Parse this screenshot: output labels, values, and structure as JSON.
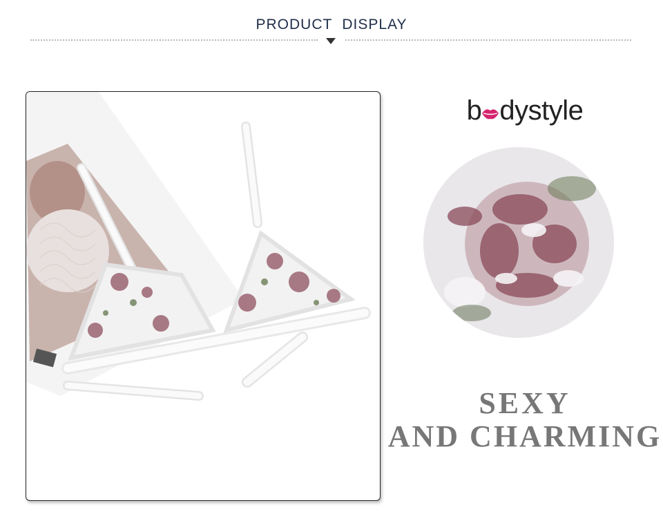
{
  "header": {
    "title_word1": "PRODUCT",
    "title_word2": "DISPLAY"
  },
  "brand": {
    "prefix": "b",
    "suffix": "dystyle",
    "accent_color": "#d6246e"
  },
  "tagline": {
    "line1": "SEXY",
    "line2": "AND CHARMING"
  },
  "icons": {
    "caret": "caret-down-icon",
    "brand_o": "lips-icon"
  }
}
